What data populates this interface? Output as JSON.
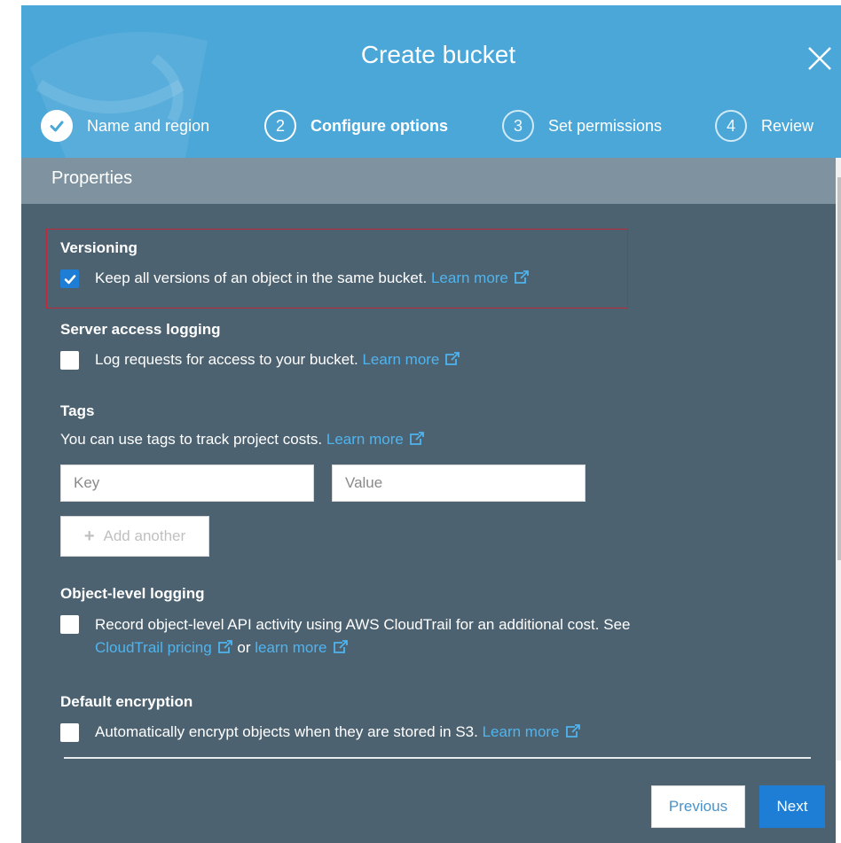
{
  "dialog": {
    "title": "Create bucket",
    "close_label": "Close"
  },
  "steps": [
    {
      "number": "",
      "label": "Name and region",
      "state": "done"
    },
    {
      "number": "2",
      "label": "Configure options",
      "state": "active"
    },
    {
      "number": "3",
      "label": "Set permissions",
      "state": "pending"
    },
    {
      "number": "4",
      "label": "Review",
      "state": "pending"
    }
  ],
  "properties": {
    "header": "Properties",
    "versioning": {
      "title": "Versioning",
      "text": "Keep all versions of an object in the same bucket.",
      "link": "Learn more",
      "checked": true
    },
    "server_access_logging": {
      "title": "Server access logging",
      "text": "Log requests for access to your bucket.",
      "link": "Learn more",
      "checked": false
    },
    "tags": {
      "title": "Tags",
      "text": "You can use tags to track project costs.",
      "link": "Learn more",
      "key_placeholder": "Key",
      "value_placeholder": "Value",
      "add_label": "Add another"
    },
    "object_level_logging": {
      "title": "Object-level logging",
      "text": "Record object-level API activity using AWS CloudTrail for an additional cost. See",
      "link_pricing": "CloudTrail pricing",
      "or": "or",
      "link_learn": "learn more",
      "checked": false
    },
    "default_encryption": {
      "title": "Default encryption",
      "text": "Automatically encrypt objects when they are stored in S3.",
      "link": "Learn more",
      "checked": false
    }
  },
  "footer": {
    "previous_label": "Previous",
    "next_label": "Next"
  },
  "colors": {
    "header_blue": "#4aa7d8",
    "content_bg": "#4d6270",
    "properties_bar": "#7e939f",
    "link": "#4fb4ee",
    "primary_button": "#1e7dd4",
    "highlight_border": "#c0283a"
  }
}
